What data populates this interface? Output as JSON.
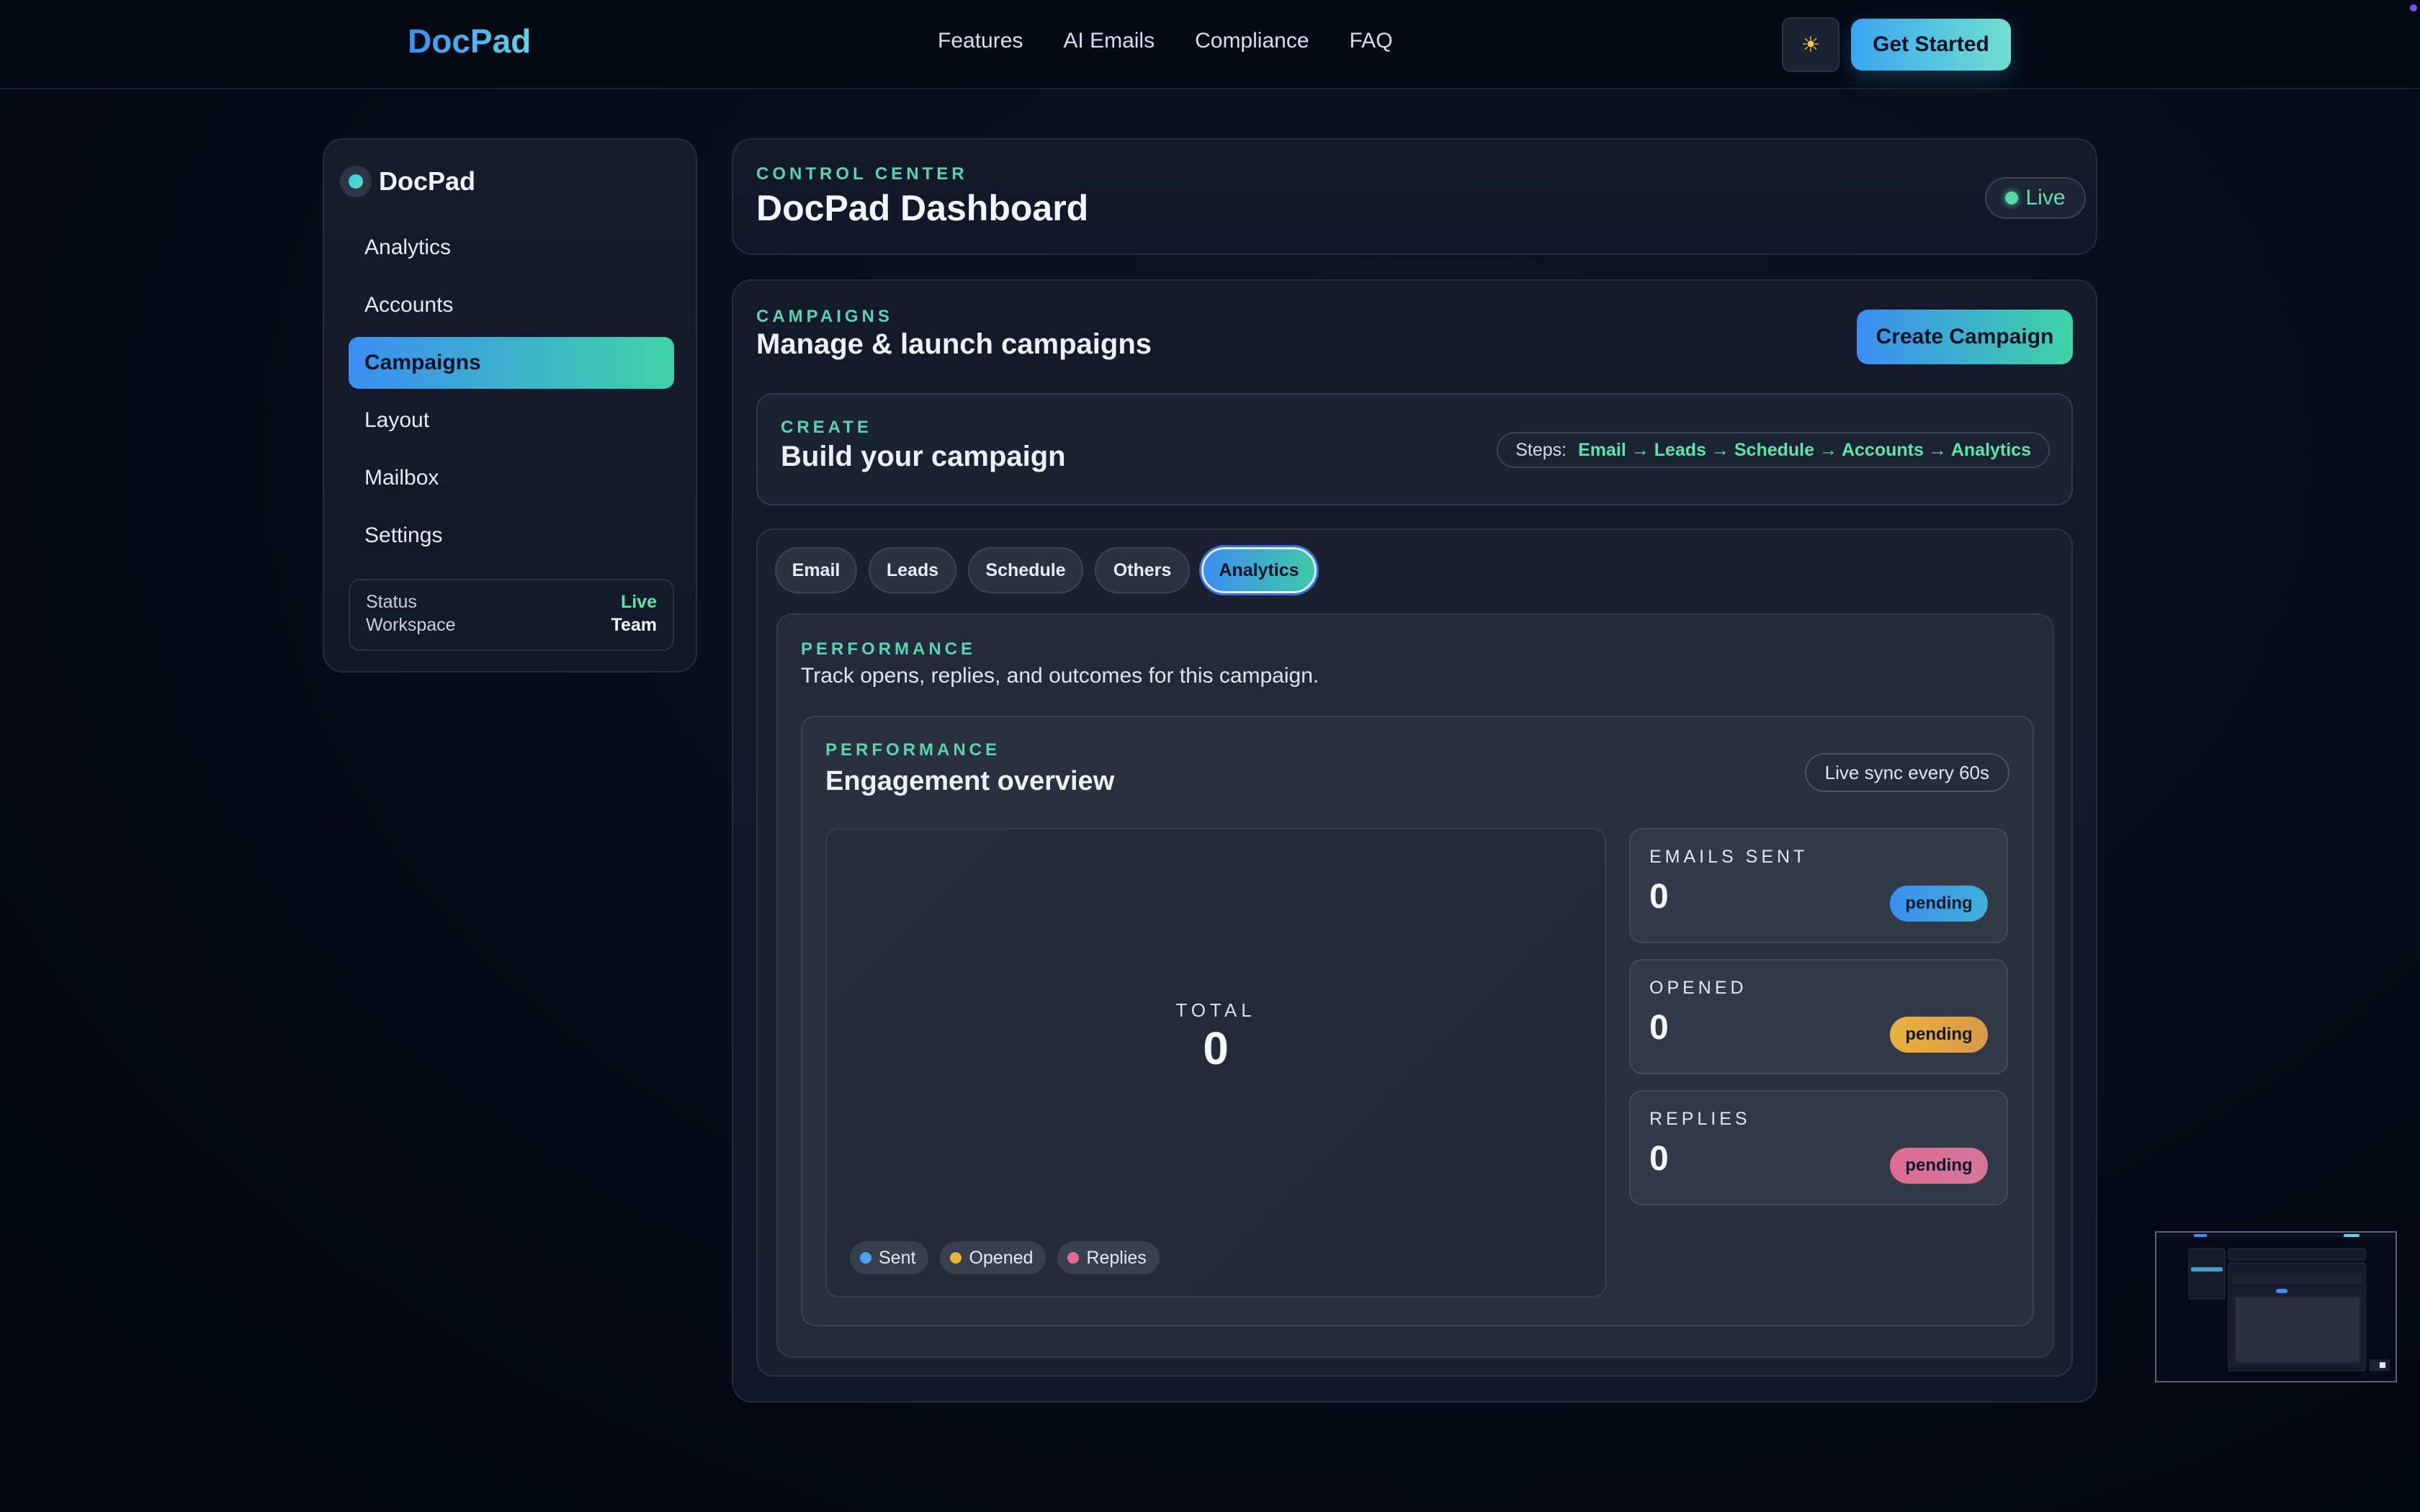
{
  "topnav": {
    "brand": "DocPad",
    "links": [
      "Features",
      "AI Emails",
      "Compliance",
      "FAQ"
    ],
    "theme_icon": "sun-icon",
    "cta": "Get Started"
  },
  "sidebar": {
    "brand": "DocPad",
    "items": [
      {
        "label": "Analytics"
      },
      {
        "label": "Accounts"
      },
      {
        "label": "Campaigns"
      },
      {
        "label": "Layout"
      },
      {
        "label": "Mailbox"
      },
      {
        "label": "Settings"
      }
    ],
    "active_item": "Campaigns",
    "status": {
      "status_label": "Status",
      "status_value": "Live",
      "workspace_label": "Workspace",
      "workspace_value": "Team"
    }
  },
  "header": {
    "eyebrow": "CONTROL CENTER",
    "title": "DocPad Dashboard",
    "live_label": "Live"
  },
  "campaigns": {
    "eyebrow": "CAMPAIGNS",
    "title": "Manage & launch campaigns",
    "create_button": "Create Campaign",
    "build": {
      "eyebrow": "CREATE",
      "title": "Build your campaign",
      "steps_label": "Steps:",
      "steps_flow": "Email → Leads → Schedule → Accounts → Analytics"
    },
    "tabs": [
      "Email",
      "Leads",
      "Schedule",
      "Others",
      "Analytics"
    ],
    "active_tab": "Analytics",
    "performance": {
      "eyebrow": "PERFORMANCE",
      "description": "Track opens, replies, and outcomes for this campaign.",
      "card": {
        "eyebrow": "PERFORMANCE",
        "title": "Engagement overview",
        "sync": "Live sync every 60s",
        "total_label": "TOTAL",
        "total_value": "0",
        "legend": [
          {
            "label": "Sent",
            "color": "#4aa3f0"
          },
          {
            "label": "Opened",
            "color": "#e7b23e"
          },
          {
            "label": "Replies",
            "color": "#e06b93"
          }
        ],
        "stats": [
          {
            "label": "EMAILS SENT",
            "value": "0",
            "badge": "pending",
            "color": "#3d9ad9"
          },
          {
            "label": "OPENED",
            "value": "0",
            "badge": "pending",
            "color": "#e2a83e"
          },
          {
            "label": "REPLIES",
            "value": "0",
            "badge": "pending",
            "color": "#d97195"
          }
        ]
      }
    }
  },
  "colors": {
    "accent_blue": "#3b8ef2",
    "accent_green": "#3fd3a6",
    "live_green": "#5fe3a9"
  }
}
